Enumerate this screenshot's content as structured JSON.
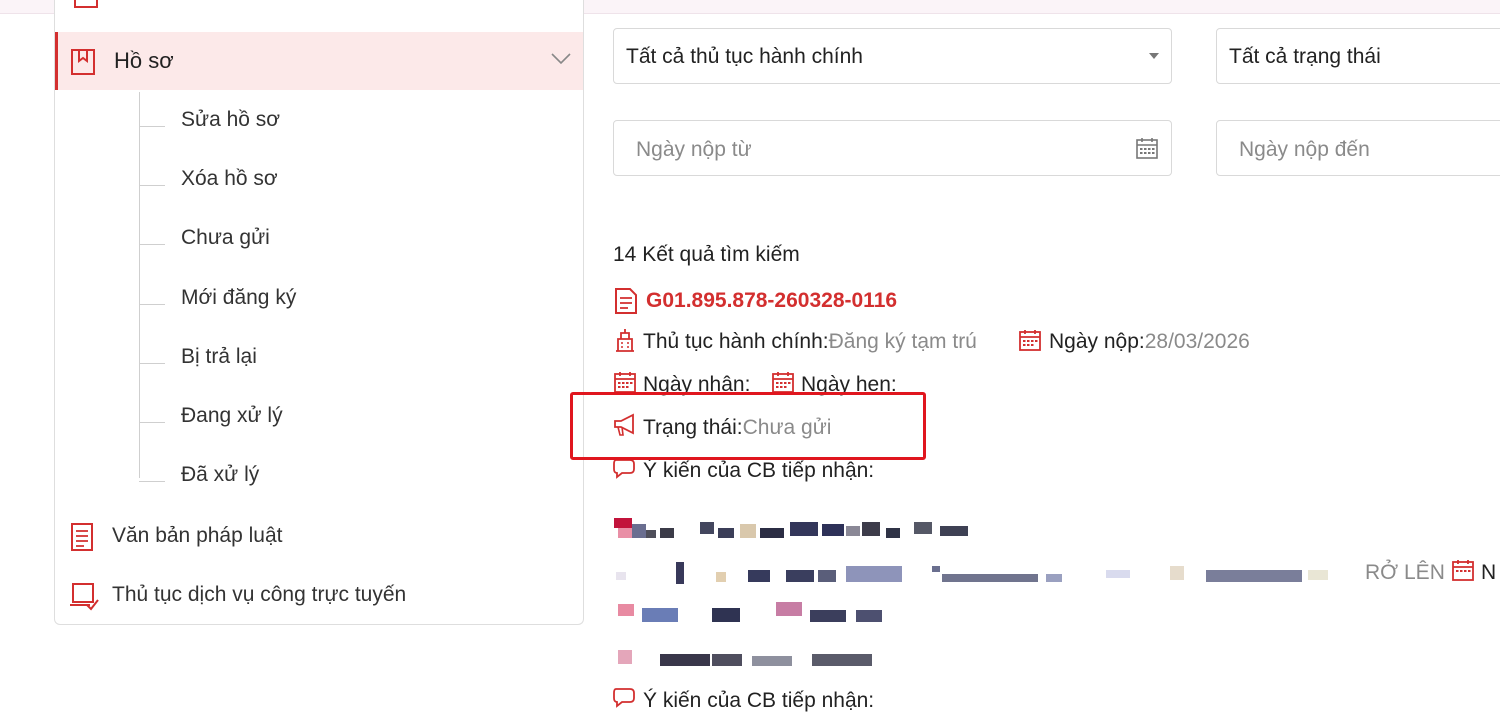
{
  "sidebar": {
    "active_item": {
      "label": "Hồ sơ",
      "icon": "bookmark-icon"
    },
    "sub_items": [
      {
        "label": "Sửa hồ sơ"
      },
      {
        "label": "Xóa hồ sơ"
      },
      {
        "label": "Chưa gửi"
      },
      {
        "label": "Mới đăng ký"
      },
      {
        "label": "Bị trả lại"
      },
      {
        "label": "Đang xử lý"
      },
      {
        "label": "Đã xử lý"
      }
    ],
    "items": [
      {
        "label": "Văn bản pháp luật",
        "icon": "document-icon"
      },
      {
        "label": "Thủ tục dịch vụ công trực tuyến",
        "icon": "laptop-check-icon"
      }
    ]
  },
  "filters": {
    "procedure_select": {
      "value": "Tất cả thủ tục hành chính"
    },
    "status_select": {
      "value": "Tất cả trạng thái"
    },
    "date_from": {
      "placeholder": "Ngày nộp từ"
    },
    "date_to": {
      "placeholder": "Ngày nộp đến"
    }
  },
  "results": {
    "count_text": "14 Kết quả tìm kiếm",
    "record": {
      "code": "G01.895.878-260328-0116",
      "procedure_label": "Thủ tục hành chính:",
      "procedure_value": "Đăng ký tạm trú",
      "submit_date_label": "Ngày nộp:",
      "submit_date_value": "28/03/2026",
      "received_label": "Ngày nhận:",
      "appointment_label": "Ngày hẹn:",
      "status_label": "Trạng thái:",
      "status_value": "Chưa gửi",
      "opinion_label": "Ý kiến của CB tiếp nhận:"
    },
    "partial_text": "RỞ LÊN",
    "partial_text_2": "N",
    "opinion_label_2": "Ý kiến của CB tiếp nhận:"
  },
  "colors": {
    "accent": "#d32f2f",
    "active_bg": "#fce9e9",
    "highlight": "#e0161e"
  }
}
